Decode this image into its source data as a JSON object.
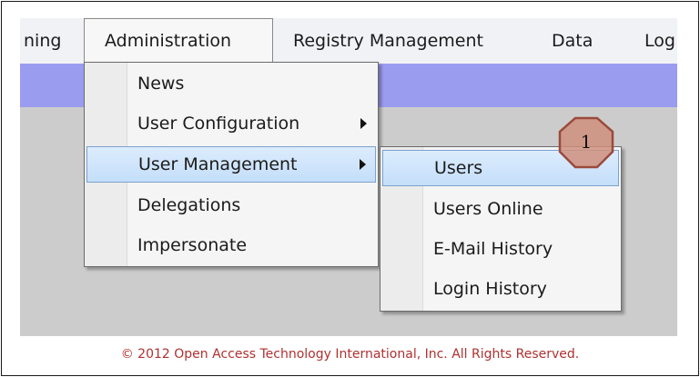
{
  "menubar": {
    "items": [
      {
        "label": "ning"
      },
      {
        "label": "Administration"
      },
      {
        "label": "Registry Management"
      },
      {
        "label": "Data"
      },
      {
        "label": "Log"
      }
    ]
  },
  "admin_menu": {
    "items": [
      {
        "label": "News"
      },
      {
        "label": "User Configuration"
      },
      {
        "label": "User Management"
      },
      {
        "label": "Delegations"
      },
      {
        "label": "Impersonate"
      }
    ]
  },
  "user_mgmt_submenu": {
    "items": [
      {
        "label": "Users"
      },
      {
        "label": "Users Online"
      },
      {
        "label": "E-Mail History"
      },
      {
        "label": "Login History"
      }
    ]
  },
  "callout": {
    "number": "1",
    "color": "#c98a7a"
  },
  "footer": {
    "copyright": "© 2012 Open Access Technology International, Inc. All Rights Reserved."
  },
  "colors": {
    "menu_strip": "#9a9cf0",
    "highlight": "#cfe3fb",
    "content_bg": "#cccccc",
    "copyright_text": "#b03030"
  }
}
